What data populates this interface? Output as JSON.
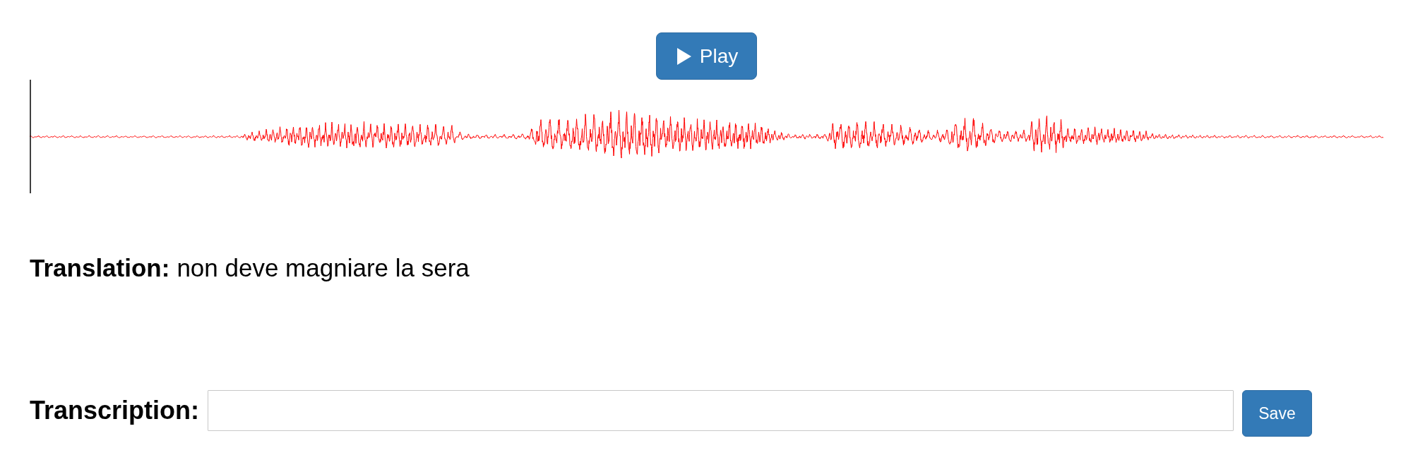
{
  "play_button": {
    "label": "Play"
  },
  "translation": {
    "label": "Translation:",
    "text": "non deve magniare la sera"
  },
  "transcription": {
    "label": "Transcription:"
  },
  "save_button": {
    "label": "Save"
  }
}
